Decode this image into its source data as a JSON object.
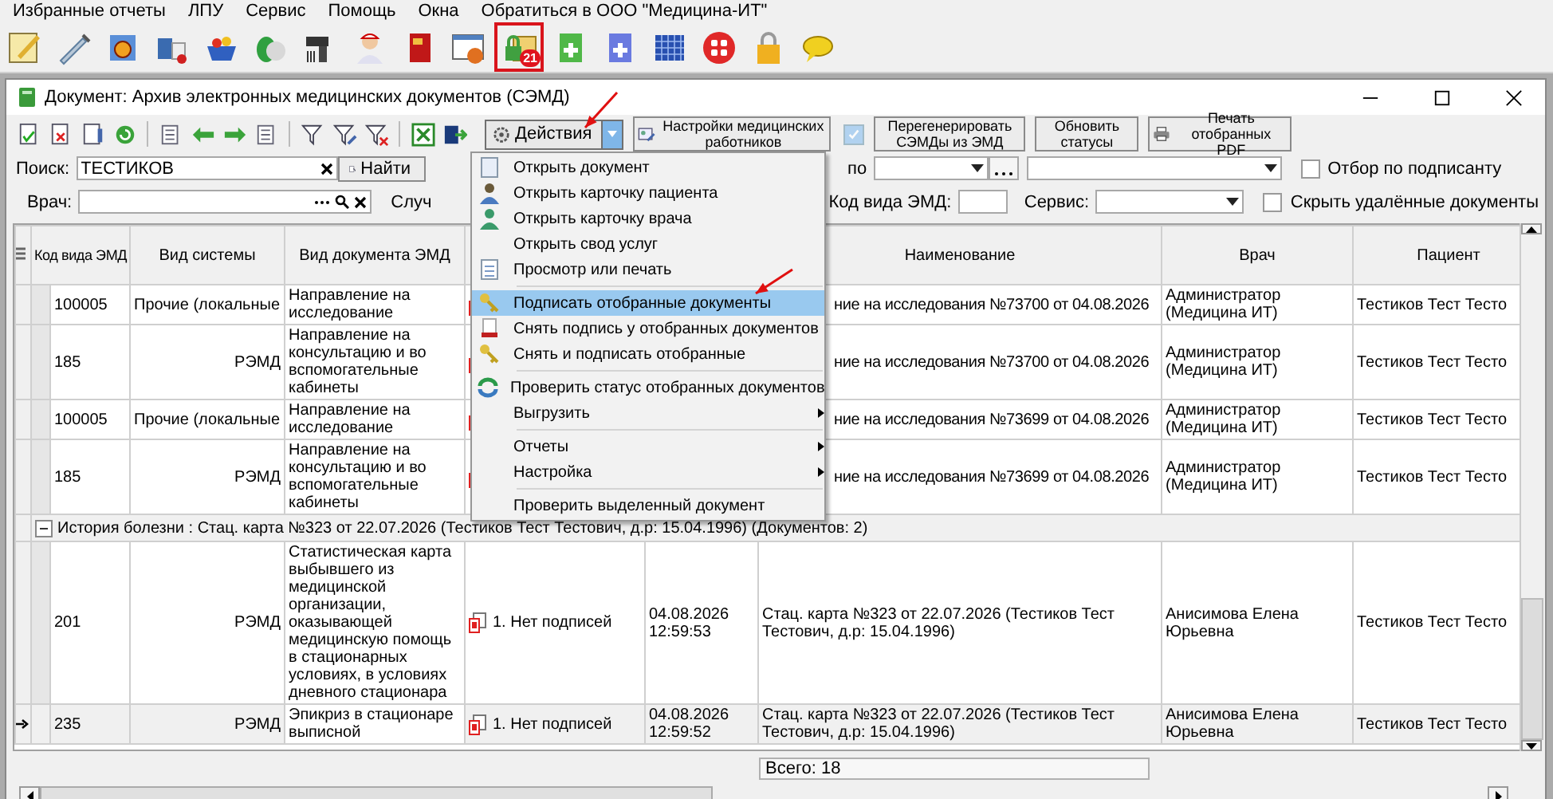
{
  "menu_bar": [
    "Избранные отчеты",
    "ЛПУ",
    "Сервис",
    "Помощь",
    "Окна",
    "Обратиться в ООО \"Медицина-ИТ\""
  ],
  "toolbar": [
    {
      "selected": false
    },
    {
      "selected": false
    },
    {
      "selected": false
    },
    {
      "selected": false
    },
    {
      "selected": false
    },
    {
      "selected": false
    },
    {
      "selected": false
    },
    {
      "selected": false
    },
    {
      "selected": false
    },
    {
      "selected": false
    },
    {
      "selected": true,
      "badge": "21"
    },
    {
      "selected": false
    },
    {
      "selected": false
    },
    {
      "selected": false
    },
    {
      "selected": false
    },
    {
      "selected": false
    },
    {
      "selected": false
    }
  ],
  "window": {
    "title": "Документ: Архив электронных медицинских документов (СЭМД)"
  },
  "window_toolbar": {
    "actions_button": "Действия",
    "actions_dropdown_open": true,
    "buttons": [
      {
        "label": "Настройки медицинских работников",
        "kind": "settings"
      },
      {
        "label": "Перегенерировать СЭМДы из ЭМД",
        "kind": "plain"
      },
      {
        "label": "Обновить статусы",
        "kind": "plain"
      },
      {
        "label": "Печать отобранных PDF",
        "kind": "print"
      }
    ],
    "checkbox": {
      "checked": true,
      "disabled": true
    }
  },
  "filters": {
    "search_label": "Поиск:",
    "search_value": "ТЕСТИКОВ",
    "find_button": "Найти",
    "by_label": "по",
    "doctor_label": "Врач:",
    "case_label": "Случ",
    "emd_code_label": "Код вида ЭМД:",
    "service_label": "Сервис:",
    "checkboxes": [
      {
        "label": "Отбор по подписанту",
        "checked": false
      },
      {
        "label": "Скрыть удалённые документы",
        "checked": false
      }
    ]
  },
  "table": {
    "columns": [
      "Код вида ЭМД",
      "Вид системы",
      "Вид документа ЭМД",
      "",
      "",
      "Наименование",
      "Врач",
      "Пациент"
    ],
    "rows": [
      {
        "kind": "record",
        "selected": false,
        "code": "100005",
        "system": "Прочие (локальные",
        "document_type": "Направление на исследование",
        "name": "ние на исследования №73700 от 04.08.2026",
        "doctor": "Администратор (Медицина ИТ)",
        "patient": "Тестиков Тест Тесто"
      },
      {
        "kind": "record",
        "selected": false,
        "code": "185",
        "system": "РЭМД",
        "document_type": "Направление на консультацию и во вспомогательные кабинеты",
        "name": "ние на исследования №73700 от 04.08.2026",
        "doctor": "Администратор (Медицина ИТ)",
        "patient": "Тестиков Тест Тесто"
      },
      {
        "kind": "record",
        "selected": false,
        "code": "100005",
        "system": "Прочие (локальные",
        "document_type": "Направление на исследование",
        "name": "ние на исследования №73699 от 04.08.2026",
        "doctor": "Администратор (Медицина ИТ)",
        "patient": "Тестиков Тест Тесто"
      },
      {
        "kind": "record",
        "selected": false,
        "code": "185",
        "system": "РЭМД",
        "document_type": "Направление на консультацию и во вспомогательные кабинеты",
        "name": "ние на исследования №73699 от 04.08.2026",
        "doctor": "Администратор (Медицина ИТ)",
        "patient": "Тестиков Тест Тесто"
      },
      {
        "kind": "group",
        "expanded": true,
        "label": "История болезни : Стац. карта №323 от 22.07.2026 (Тестиков Тест Тестович, д.р: 15.04.1996) (Документов: 2)"
      },
      {
        "kind": "record",
        "selected": false,
        "code": "201",
        "system": "РЭМД",
        "document_type": "Статистическая карта выбывшего из медицинской организации, оказывающей медицинскую помощь в стационарных условиях, в условиях дневного стационара",
        "status": "1. Нет подписей",
        "date": "04.08.2026 12:59:53",
        "name": "Стац. карта №323 от 22.07.2026 (Тестиков Тест Тестович, д.р: 15.04.1996)",
        "doctor": "Анисимова Елена Юрьевна",
        "patient": "Тестиков Тест Тесто"
      },
      {
        "kind": "record",
        "selected": true,
        "code": "235",
        "system": "РЭМД",
        "document_type": "Эпикриз в стационаре выписной",
        "status": "1. Нет подписей",
        "date": "04.08.2026 12:59:52",
        "name": "Стац. карта №323 от 22.07.2026 (Тестиков Тест Тестович, д.р: 15.04.1996)",
        "doctor": "Анисимова Елена Юрьевна",
        "patient": "Тестиков Тест Тесто"
      }
    ]
  },
  "total": "Всего: 18",
  "context_menu": {
    "items": [
      {
        "kind": "item",
        "label": "Открыть документ",
        "selected": false
      },
      {
        "kind": "item",
        "label": "Открыть карточку пациента",
        "selected": false
      },
      {
        "kind": "item",
        "label": "Открыть карточку врача",
        "selected": false
      },
      {
        "kind": "item",
        "label": "Открыть свод услуг",
        "selected": false
      },
      {
        "kind": "item",
        "label": "Просмотр или печать",
        "selected": false
      },
      {
        "kind": "separator"
      },
      {
        "kind": "item",
        "label": "Подписать отобранные документы",
        "selected": true
      },
      {
        "kind": "item",
        "label": "Снять подпись у отобранных документов",
        "selected": false
      },
      {
        "kind": "item",
        "label": "Снять и подписать отобранные",
        "selected": false
      },
      {
        "kind": "separator"
      },
      {
        "kind": "item",
        "label": "Проверить статус отобранных документов",
        "selected": false
      },
      {
        "kind": "submenu",
        "label": "Выгрузить",
        "selected": false
      },
      {
        "kind": "separator"
      },
      {
        "kind": "submenu",
        "label": "Отчеты",
        "selected": false
      },
      {
        "kind": "submenu",
        "label": "Настройка",
        "selected": false
      },
      {
        "kind": "separator"
      },
      {
        "kind": "item",
        "label": "Проверить выделенный документ",
        "selected": false
      }
    ]
  }
}
